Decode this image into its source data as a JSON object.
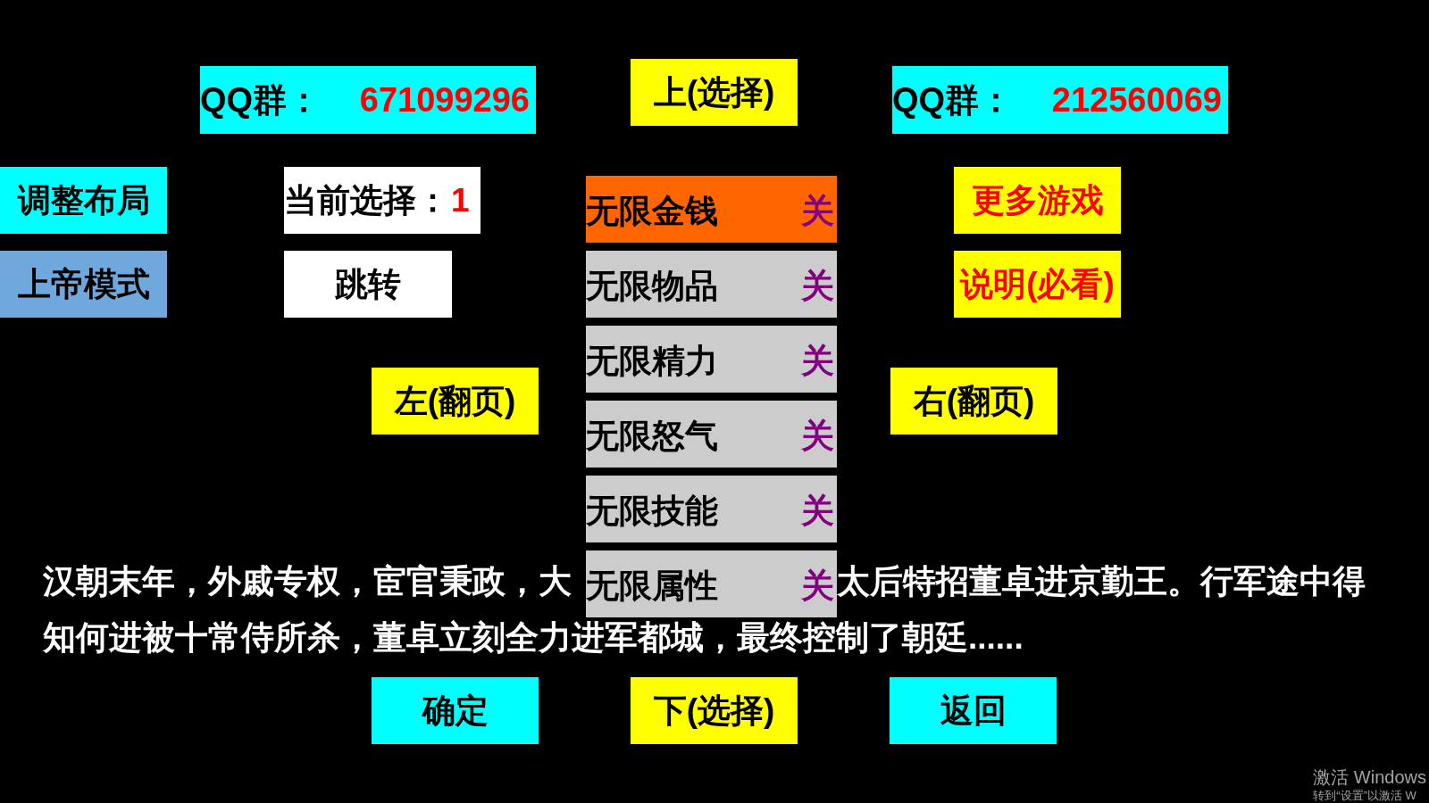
{
  "qq_group_left": {
    "label": "QQ群：",
    "number": "671099296"
  },
  "up_select_button": {
    "label": "上(选择)"
  },
  "qq_group_right": {
    "label": "QQ群：",
    "number": "212560069"
  },
  "left_buttons": [
    {
      "label": "调整布局"
    },
    {
      "label": "上帝模式"
    }
  ],
  "current_selection": {
    "label": "当前选择：",
    "value": "1"
  },
  "jump_button": {
    "label": "跳转"
  },
  "cheat_list": [
    {
      "label": "无限金钱",
      "state": "关",
      "selected": true
    },
    {
      "label": "无限物品",
      "state": "关",
      "selected": false
    },
    {
      "label": "无限精力",
      "state": "关",
      "selected": false
    },
    {
      "label": "无限怒气",
      "state": "关",
      "selected": false
    },
    {
      "label": "无限技能",
      "state": "关",
      "selected": false
    },
    {
      "label": "无限属性",
      "state": "关",
      "selected": false
    }
  ],
  "right_buttons": [
    {
      "label": "更多游戏"
    },
    {
      "label": "说明(必看)"
    }
  ],
  "page_buttons": [
    {
      "label": "左(翻页)"
    },
    {
      "label": "右(翻页)"
    }
  ],
  "story_lines": [
    {
      "segments": [
        "汉朝末年，外戚专权，宦官秉政，大",
        "太后特招董卓进京勤王。行军途中得"
      ]
    },
    {
      "segments": [
        "知何进被十常侍所杀，董卓立刻全力进军都城，最终控制了朝廷......"
      ]
    }
  ],
  "bottom_buttons": [
    {
      "label": "确定"
    },
    {
      "label": "下(选择)"
    },
    {
      "label": "返回"
    }
  ],
  "activation_notice": {
    "title": "激活 Windows",
    "hint": "转到“设置”以激活 W"
  }
}
